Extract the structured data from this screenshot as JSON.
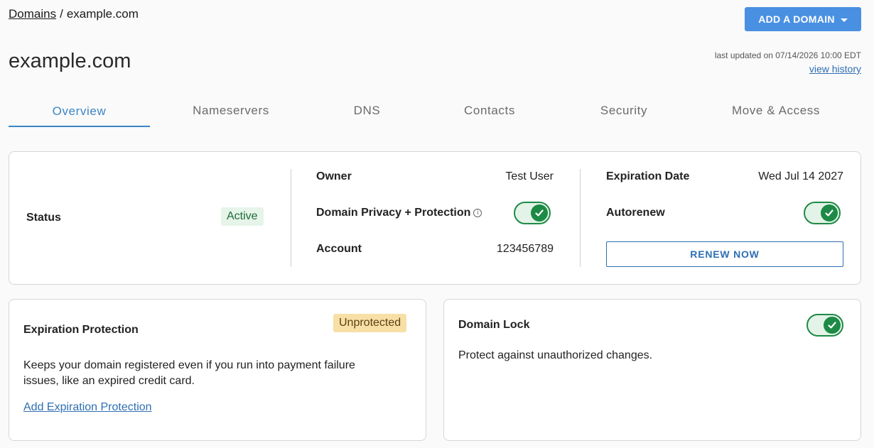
{
  "breadcrumb": {
    "root": "Domains",
    "separator": "/",
    "current": "example.com"
  },
  "header": {
    "add_domain_label": "ADD A DOMAIN",
    "title": "example.com",
    "last_updated": "last updated on 07/14/2026 10:00 EDT",
    "view_history": "view history"
  },
  "tabs": [
    {
      "label": "Overview",
      "active": true
    },
    {
      "label": "Nameservers"
    },
    {
      "label": "DNS"
    },
    {
      "label": "Contacts"
    },
    {
      "label": "Security"
    },
    {
      "label": "Move & Access"
    }
  ],
  "summary": {
    "status_label": "Status",
    "status_value": "Active",
    "owner_label": "Owner",
    "owner_value": "Test User",
    "privacy_label": "Domain Privacy + Protection",
    "privacy_enabled": true,
    "account_label": "Account",
    "account_value": "123456789",
    "expiration_label": "Expiration Date",
    "expiration_value": "Wed Jul 14 2027",
    "autorenew_label": "Autorenew",
    "autorenew_enabled": true,
    "renew_label": "RENEW NOW"
  },
  "expiration_protection": {
    "title": "Expiration Protection",
    "badge": "Unprotected",
    "description": "Keeps your domain registered even if you run into payment failure issues, like an expired credit card.",
    "link": "Add Expiration Protection"
  },
  "domain_lock": {
    "title": "Domain Lock",
    "enabled": true,
    "description": "Protect against unauthorized changes."
  },
  "colors": {
    "accent": "#4a90e2",
    "toggle_green": "#1d8a45",
    "link": "#2f6fb3",
    "badge_warn": "#f7dfa6",
    "badge_ok": "#e6f4ea"
  }
}
